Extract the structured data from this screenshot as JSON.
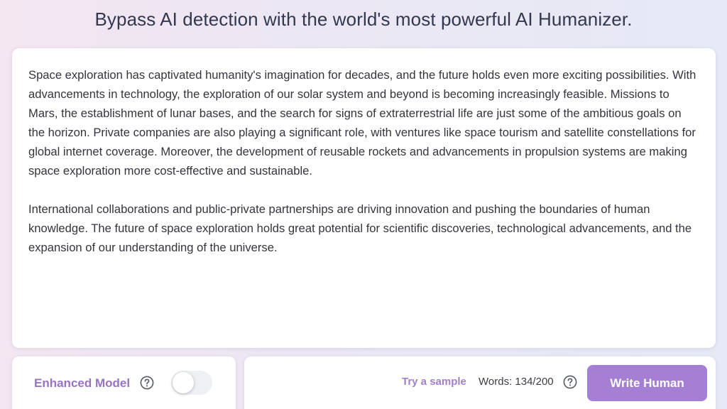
{
  "header": {
    "title": "Bypass AI detection with the world's most powerful AI Humanizer."
  },
  "editor": {
    "paragraphs": [
      "Space exploration has captivated humanity's imagination for decades, and the future holds even more exciting possibilities. With advancements in technology, the exploration of our solar system and beyond is becoming increasingly feasible. Missions to Mars, the establishment of lunar bases, and the search for signs of extraterrestrial life are just some of the ambitious goals on the horizon. Private companies are also playing a significant role, with ventures like space tourism and satellite constellations for global internet coverage. Moreover, the development of reusable rockets and advancements in propulsion systems are making space exploration more cost-effective and sustainable.",
      "International collaborations and public-private partnerships are driving innovation and pushing the boundaries of human knowledge. The future of space exploration holds great potential for scientific discoveries, technological advancements, and the expansion of our understanding of the universe."
    ]
  },
  "model_panel": {
    "label": "Enhanced Model",
    "help_icon": "question-circle-icon",
    "toggle_on": false
  },
  "action_panel": {
    "sample_link": "Try a sample",
    "word_count": "Words: 134/200",
    "help_icon": "question-circle-icon",
    "submit_label": "Write Human"
  },
  "colors": {
    "accent": "#a57fd4",
    "accent_text": "#9a72c4"
  }
}
